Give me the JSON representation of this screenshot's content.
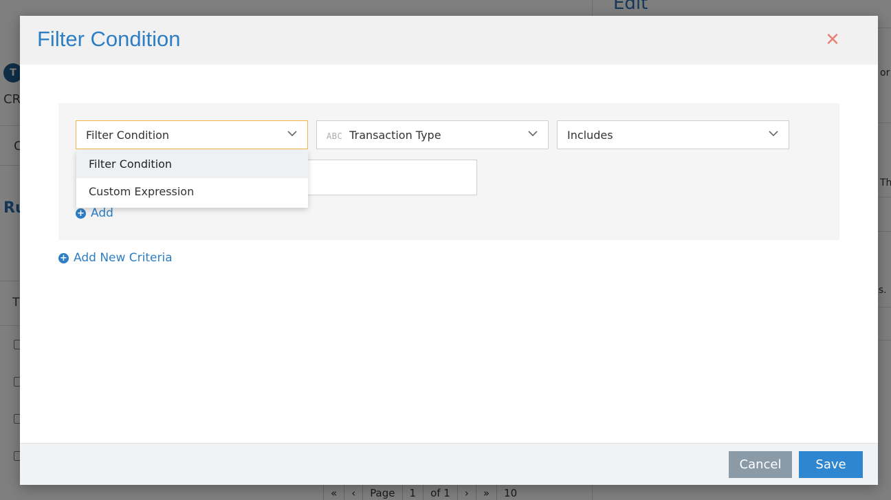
{
  "background": {
    "right_panel_title": "Edit",
    "right_fragments": [
      "or",
      "Th",
      "ls."
    ],
    "left_fragments": [
      "CR",
      "C",
      "Ru",
      "T"
    ],
    "avatar_letter": "T",
    "pager": {
      "page_label": "Page",
      "page_value": "1",
      "of_label": "of 1",
      "per_page": "10"
    }
  },
  "modal": {
    "title": "Filter Condition",
    "close_icon": "close-icon",
    "condition_row": {
      "type_select": {
        "value": "Filter Condition"
      },
      "field_select": {
        "type_badge": "ABC",
        "value": "Transaction Type"
      },
      "operator_select": {
        "value": "Includes"
      }
    },
    "dropdown": {
      "options": [
        {
          "label": "Filter Condition",
          "active": true
        },
        {
          "label": "Custom Expression",
          "active": false
        }
      ]
    },
    "add_label": "Add",
    "add_criteria_label": "Add New Criteria",
    "footer": {
      "cancel_label": "Cancel",
      "save_label": "Save"
    }
  },
  "colors": {
    "accent": "#2d7ec4",
    "close": "#e8837a",
    "focus_border": "#f0b34a",
    "cancel_bg": "#8a9aa7",
    "save_bg": "#2f86d0"
  }
}
